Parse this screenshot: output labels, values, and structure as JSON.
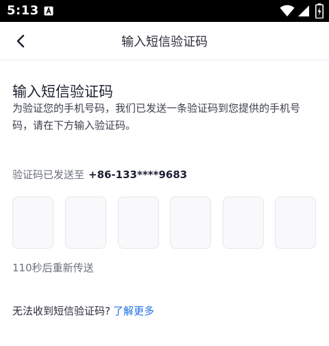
{
  "status_bar": {
    "time": "5:13",
    "icons": [
      "notification-a-icon",
      "wifi-icon",
      "signal-icon",
      "battery-icon"
    ]
  },
  "nav": {
    "title": "输入短信验证码",
    "back_icon": "chevron-left-icon"
  },
  "main": {
    "heading": "输入短信验证码",
    "description": "为验证您的手机号码，我们已发送一条验证码到您提供的手机号码，请在下方输入验证码。",
    "sent_prefix": "验证码已发送至",
    "phone_number": "+86-133****9683",
    "code_boxes": [
      "",
      "",
      "",
      "",
      "",
      ""
    ],
    "resend_countdown": "110秒后重新传送",
    "help_question": "无法收到短信验证码?",
    "learn_more": "了解更多"
  },
  "colors": {
    "link": "#1f6fe5",
    "text_dark": "#1f2230",
    "text_muted": "#6b6f7d",
    "box_border": "#e6e7ec",
    "box_fill": "#f9f9fb"
  }
}
